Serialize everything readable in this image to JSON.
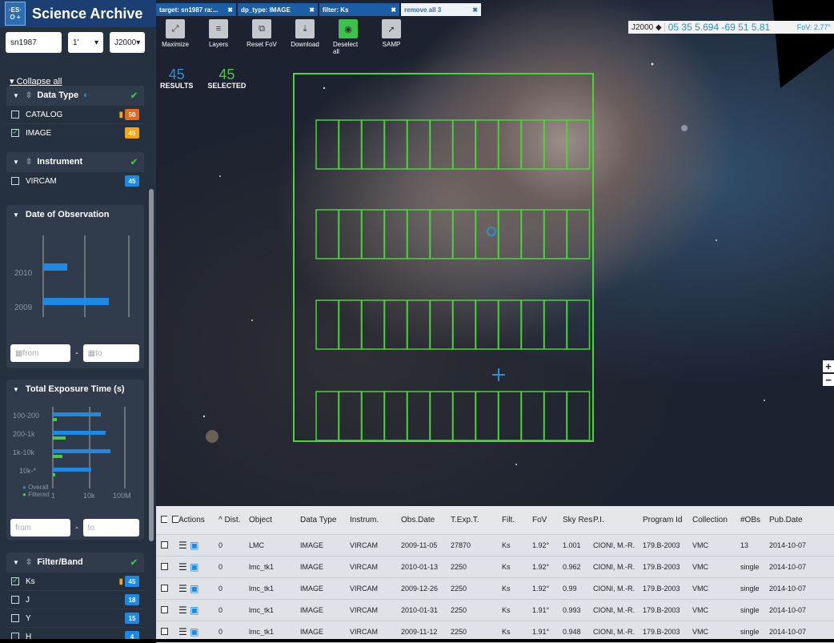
{
  "app": {
    "logo": "·ES· O +",
    "title": "Science Archive"
  },
  "search": {
    "target": "sn1987",
    "radius": "1'",
    "coord_system": "J2000"
  },
  "sidebar": {
    "collapse_label": "Collapse all",
    "data_type": {
      "title": "Data Type",
      "items": [
        {
          "label": "CATALOG",
          "count": "50",
          "checked": false,
          "count_color": "#e56a1f"
        },
        {
          "label": "IMAGE",
          "count": "45",
          "checked": true,
          "count_color": "#f0a51a"
        }
      ]
    },
    "instrument": {
      "title": "Instrument",
      "items": [
        {
          "label": "VIRCAM",
          "count": "45",
          "checked": false
        }
      ]
    },
    "date": {
      "title": "Date of Observation",
      "years": [
        "2010",
        "2009"
      ],
      "ticks": [
        "10",
        "20",
        "40"
      ],
      "from": "from",
      "to": "to"
    },
    "exposure": {
      "title": "Total Exposure Time (s)",
      "categories": [
        "100-200",
        "200-1k",
        "1k-10k",
        "10k-*"
      ],
      "ticks": [
        "1",
        "10k",
        "100M"
      ],
      "legend": [
        "Overall",
        "Filtered"
      ],
      "from": "from",
      "to": "to"
    },
    "filter": {
      "title": "Filter/Band",
      "items": [
        {
          "label": "Ks",
          "count": "45",
          "checked": true
        },
        {
          "label": "J",
          "count": "18",
          "checked": false
        },
        {
          "label": "Y",
          "count": "15",
          "checked": false
        },
        {
          "label": "H",
          "count": "4",
          "checked": false
        }
      ]
    }
  },
  "chart_data": [
    {
      "type": "bar",
      "title": "Date of Observation",
      "categories": [
        "2010",
        "2009"
      ],
      "values": [
        13,
        35
      ],
      "xlim": [
        0,
        45
      ]
    },
    {
      "type": "bar",
      "title": "Total Exposure Time (s)",
      "categories": [
        "100-200",
        "200-1k",
        "1k-10k",
        "10k-*"
      ],
      "series": [
        {
          "name": "Overall",
          "values": [
            14,
            15,
            16,
            11
          ]
        },
        {
          "name": "Filtered",
          "values": [
            1,
            3,
            2,
            0.5
          ]
        }
      ]
    }
  ],
  "tabs": [
    {
      "label": "target: sn1987 ra:..."
    },
    {
      "label": "dp_type: IMAGE"
    },
    {
      "label": "filter: Ks"
    },
    {
      "label": "remove all 3"
    }
  ],
  "toolbar": [
    {
      "label": "Maximize",
      "icon": "⤢"
    },
    {
      "label": "Layers",
      "icon": "≡"
    },
    {
      "label": "Reset FoV",
      "icon": "⧉"
    },
    {
      "label": "Download",
      "icon": "⤓"
    },
    {
      "label": "Deselect all",
      "icon": "◉"
    },
    {
      "label": "SAMP",
      "icon": "➚"
    }
  ],
  "counts": {
    "results": "45",
    "results_label": "RESULTS",
    "selected": "45",
    "selected_label": "SELECTED"
  },
  "coords": {
    "frame": "J2000 ◆",
    "value": "05 35 5.694 -69 51 5.81",
    "fov": "FoV: 2.77°"
  },
  "zoom": {
    "in": "+",
    "out": "−"
  },
  "table": {
    "headers": [
      "",
      "",
      "Actions",
      "^ Dist.",
      "Object",
      "Data Type",
      "Instrum.",
      "Obs.Date",
      "T.Exp.T.",
      "Filt.",
      "FoV",
      "Sky Res",
      "P.I.",
      "Program Id",
      "Collection",
      "#OBs",
      "Pub.Date"
    ],
    "rows": [
      [
        "0",
        "LMC",
        "IMAGE",
        "VIRCAM",
        "2009-11-05",
        "27870",
        "Ks",
        "1.92°",
        "1.001",
        "CIONI, M.-R.",
        "179.B-2003",
        "VMC",
        "13",
        "2014-10-07"
      ],
      [
        "0",
        "lmc_tk1",
        "IMAGE",
        "VIRCAM",
        "2010-01-13",
        "2250",
        "Ks",
        "1.92°",
        "0.962",
        "CIONI, M.-R.",
        "179.B-2003",
        "VMC",
        "single",
        "2014-10-07"
      ],
      [
        "0",
        "lmc_tk1",
        "IMAGE",
        "VIRCAM",
        "2009-12-26",
        "2250",
        "Ks",
        "1.92°",
        "0.99",
        "CIONI, M.-R.",
        "179.B-2003",
        "VMC",
        "single",
        "2014-10-07"
      ],
      [
        "0",
        "lmc_tk1",
        "IMAGE",
        "VIRCAM",
        "2010-01-31",
        "2250",
        "Ks",
        "1.91°",
        "0.993",
        "CIONI, M.-R.",
        "179.B-2003",
        "VMC",
        "single",
        "2014-10-07"
      ],
      [
        "0",
        "lmc_tk1",
        "IMAGE",
        "VIRCAM",
        "2009-11-12",
        "2250",
        "Ks",
        "1.91°",
        "0.948",
        "CIONI, M.-R.",
        "179.B-2003",
        "VMC",
        "single",
        "2014-10-07"
      ]
    ]
  }
}
